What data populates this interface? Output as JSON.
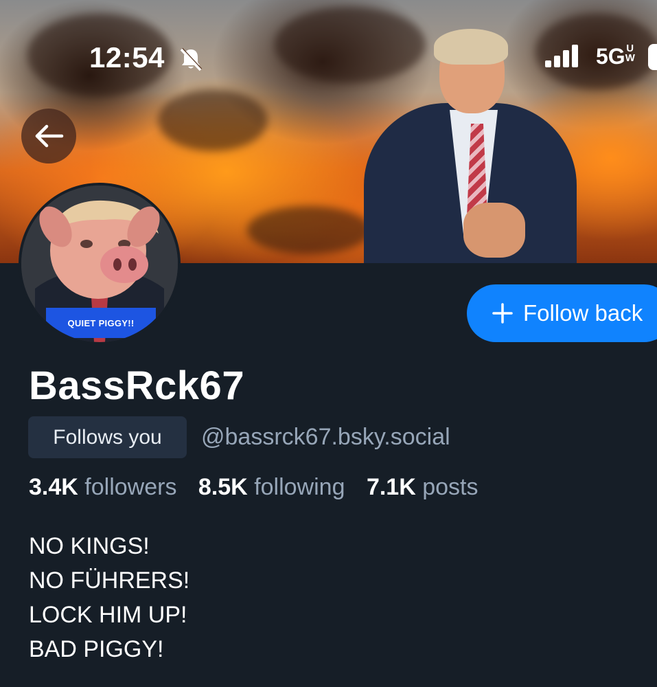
{
  "status_bar": {
    "time": "12:54",
    "network": "5G",
    "network_superscript": "UW"
  },
  "profile": {
    "avatar_caption": "QUIET PIGGY!!",
    "display_name": "BassRck67",
    "follows_you_label": "Follows you",
    "handle": "@bassrck67.bsky.social",
    "follow_button_label": "Follow back",
    "stats": [
      {
        "value": "3.4K",
        "label": "followers"
      },
      {
        "value": "8.5K",
        "label": "following"
      },
      {
        "value": "7.1K",
        "label": "posts"
      }
    ],
    "bio_lines": [
      "NO KINGS!",
      "NO FÜHRERS!",
      "LOCK HIM UP!",
      "BAD PIGGY!"
    ]
  },
  "colors": {
    "background": "#161e27",
    "accent": "#1083fe",
    "muted_text": "#97a6b8",
    "badge_bg": "#243041"
  },
  "icons": {
    "back": "arrow-left-icon",
    "bell": "bell-slash-icon",
    "signal": "cellular-signal-icon",
    "battery": "battery-icon",
    "plus": "plus-icon"
  }
}
